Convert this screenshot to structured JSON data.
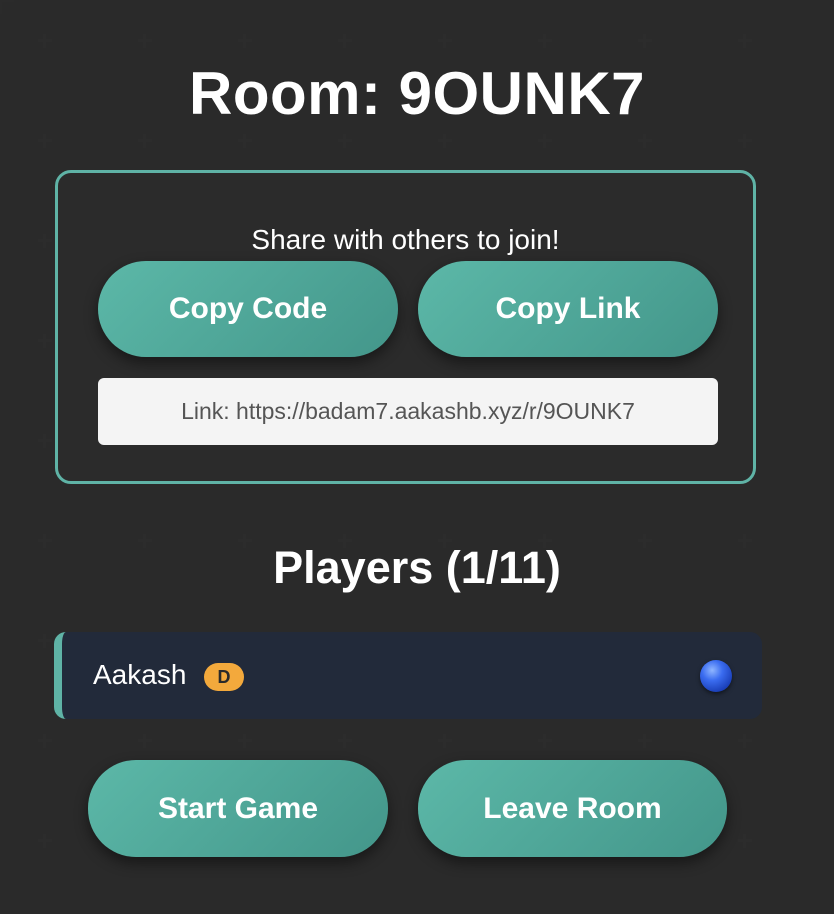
{
  "room": {
    "title": "Room: 9OUNK7"
  },
  "share": {
    "prompt": "Share with others to join!",
    "copy_code_label": "Copy Code",
    "copy_link_label": "Copy Link",
    "link_text": "Link: https://badam7.aakashb.xyz/r/9OUNK7"
  },
  "players": {
    "title": "Players (1/11)",
    "list": [
      {
        "name": "Aakash",
        "badge": "D",
        "status_color": "#2f5fe0"
      }
    ]
  },
  "actions": {
    "start_label": "Start Game",
    "leave_label": "Leave Room"
  },
  "colors": {
    "accent": "#5fb3a6",
    "badge": "#f3a93c",
    "background": "#1f1f1f"
  }
}
